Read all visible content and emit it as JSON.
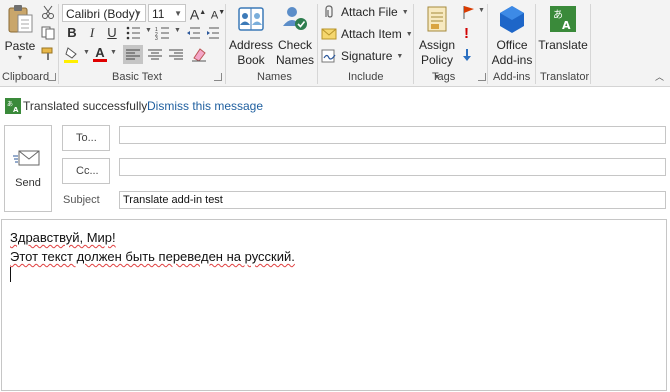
{
  "ribbon": {
    "clipboard": {
      "paste_label": "Paste",
      "group_label": "Clipboard"
    },
    "basic_text": {
      "font_name": "Calibri (Body)",
      "font_size": "11",
      "bold": "B",
      "italic": "I",
      "underline": "U",
      "grow": "A",
      "shrink": "A",
      "group_label": "Basic Text"
    },
    "names": {
      "address_book_line1": "Address",
      "address_book_line2": "Book",
      "check_names_line1": "Check",
      "check_names_line2": "Names",
      "group_label": "Names"
    },
    "include": {
      "attach_file": "Attach File",
      "attach_item": "Attach Item",
      "signature": "Signature",
      "group_label": "Include"
    },
    "tags": {
      "assign_policy_line1": "Assign",
      "assign_policy_line2": "Policy",
      "group_label": "Tags"
    },
    "addins": {
      "office_addins_line1": "Office",
      "office_addins_line2": "Add-ins",
      "group_label": "Add-ins"
    },
    "translator": {
      "translate_label": "Translate",
      "group_label": "Translator"
    }
  },
  "infobar": {
    "message": "Translated successfully",
    "dismiss": "Dismiss this message"
  },
  "compose": {
    "send_label": "Send",
    "to_label": "To...",
    "cc_label": "Cc...",
    "subject_label": "Subject",
    "to_value": "",
    "cc_value": "",
    "subject_value": "Translate add-in test",
    "body_lines": [
      "Здравствуй, Мир!",
      "Этот текст должен быть переведен на русский."
    ]
  },
  "colors": {
    "accent_blue": "#2b579a",
    "translator_green": "#3a8a3a",
    "link_blue": "#1f5f9f",
    "highlight_yellow": "#ffef00",
    "font_red": "#e00000"
  }
}
